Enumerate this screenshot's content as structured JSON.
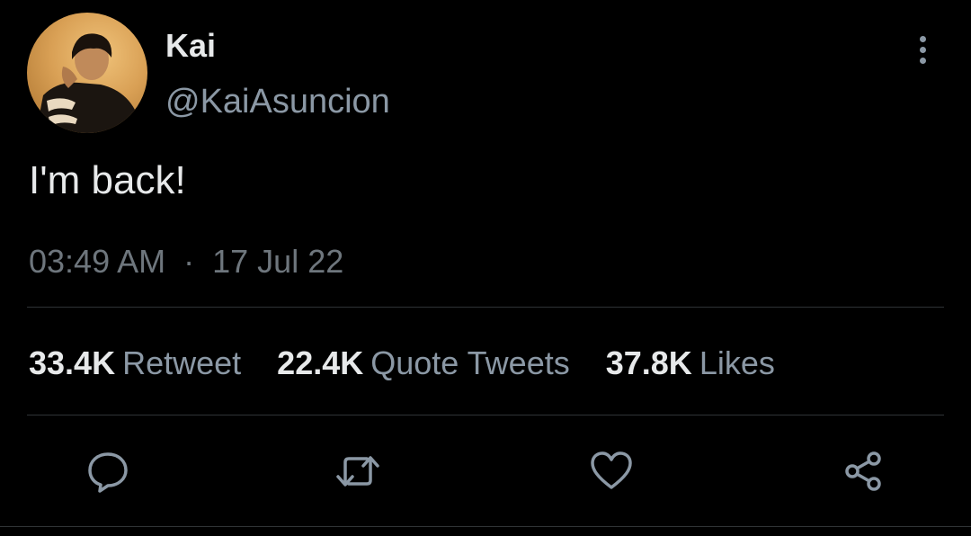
{
  "tweet": {
    "author_name": "Kai",
    "author_handle": "@KaiAsuncion",
    "text": "I'm back!",
    "time": "03:49 AM",
    "separator": "·",
    "date": "17 Jul 22"
  },
  "stats": [
    {
      "count": "33.4K",
      "label": "Retweet"
    },
    {
      "count": "22.4K",
      "label": "Quote Tweets"
    },
    {
      "count": "37.8K",
      "label": "Likes"
    }
  ],
  "actions": {
    "reply_icon": "reply-icon",
    "retweet_icon": "retweet-icon",
    "like_icon": "heart-icon",
    "share_icon": "share-icon"
  },
  "colors": {
    "background": "#000000",
    "primary_text": "#e7e9ea",
    "secondary_text": "#8b98a5",
    "meta_text": "#6e767d",
    "divider": "#2f3336"
  }
}
